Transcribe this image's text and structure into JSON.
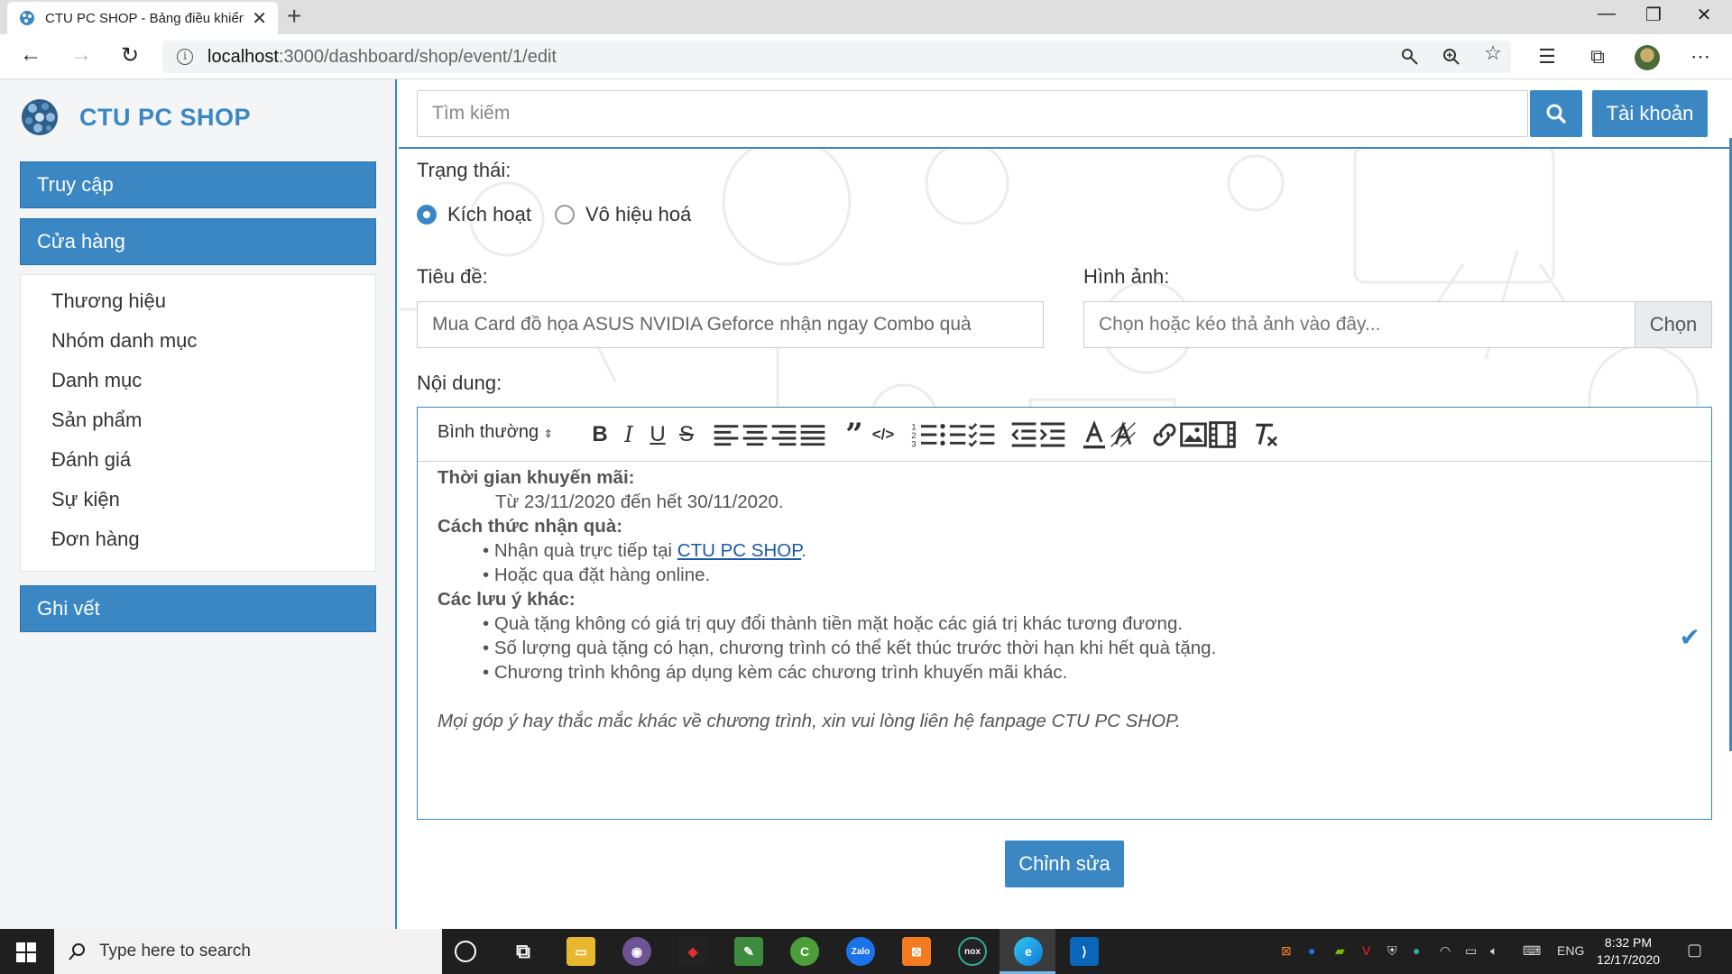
{
  "browser": {
    "tab_title": "CTU PC SHOP - Bảng điều khiển",
    "url_host": "localhost",
    "url_path": ":3000/dashboard/shop/event/1/edit",
    "new_tab_glyph": "+",
    "close_glyph": "✕"
  },
  "sidebar": {
    "brand": "CTU PC SHOP",
    "buttons": [
      "Truy cập",
      "Cửa hàng",
      "Ghi vết"
    ],
    "submenu": [
      "Thương hiệu",
      "Nhóm danh mục",
      "Danh mục",
      "Sản phẩm",
      "Đánh giá",
      "Sự kiện",
      "Đơn hàng"
    ]
  },
  "header": {
    "search_placeholder": "Tìm kiếm",
    "account_label": "Tài khoản"
  },
  "form": {
    "status_label": "Trạng thái:",
    "status_options": [
      "Kích hoạt",
      "Vô hiệu hoá"
    ],
    "status_selected": "Kích hoạt",
    "title_label": "Tiêu đề:",
    "title_value": "Mua Card đồ họa ASUS NVIDIA Geforce nhận ngay Combo quà",
    "image_label": "Hình ảnh:",
    "image_placeholder": "Chọn hoặc kéo thả ảnh vào đây...",
    "image_button": "Chọn",
    "content_label": "Nội dung:",
    "format_select": "Bình thường",
    "submit_label": "Chỉnh sửa"
  },
  "editor": {
    "heading1": "Thời gian khuyến mãi:",
    "line1": "Từ 23/11/2020 đến hết 30/11/2020.",
    "heading2": "Cách thức nhận quà:",
    "line2_prefix": "• Nhận quà trực tiếp tại ",
    "line2_link": "CTU PC SHOP",
    "line2_suffix": ".",
    "line3": "• Hoặc qua đặt hàng online.",
    "heading3": "Các lưu ý khác:",
    "line4": "• Quà tặng không có giá trị quy đổi thành tiền mặt hoặc các giá trị khác tương đương.",
    "line5": "• Số lượng quà tặng có hạn, chương trình có thể kết thúc trước thời hạn khi hết quà tặng.",
    "line6": "• Chương trình không áp dụng kèm các chương trình khuyến mãi khác.",
    "footer": "Mọi góp ý hay thắc mắc khác về chương trình, xin vui lòng liên hệ fanpage CTU PC SHOP."
  },
  "taskbar": {
    "search_text": "Type here to search",
    "lang": "ENG",
    "time": "8:32 PM",
    "date": "12/17/2020"
  },
  "colors": {
    "primary": "#3a87c4",
    "sidebar_bg": "#f4f5f6",
    "taskbar_bg": "#1f1f1f"
  }
}
